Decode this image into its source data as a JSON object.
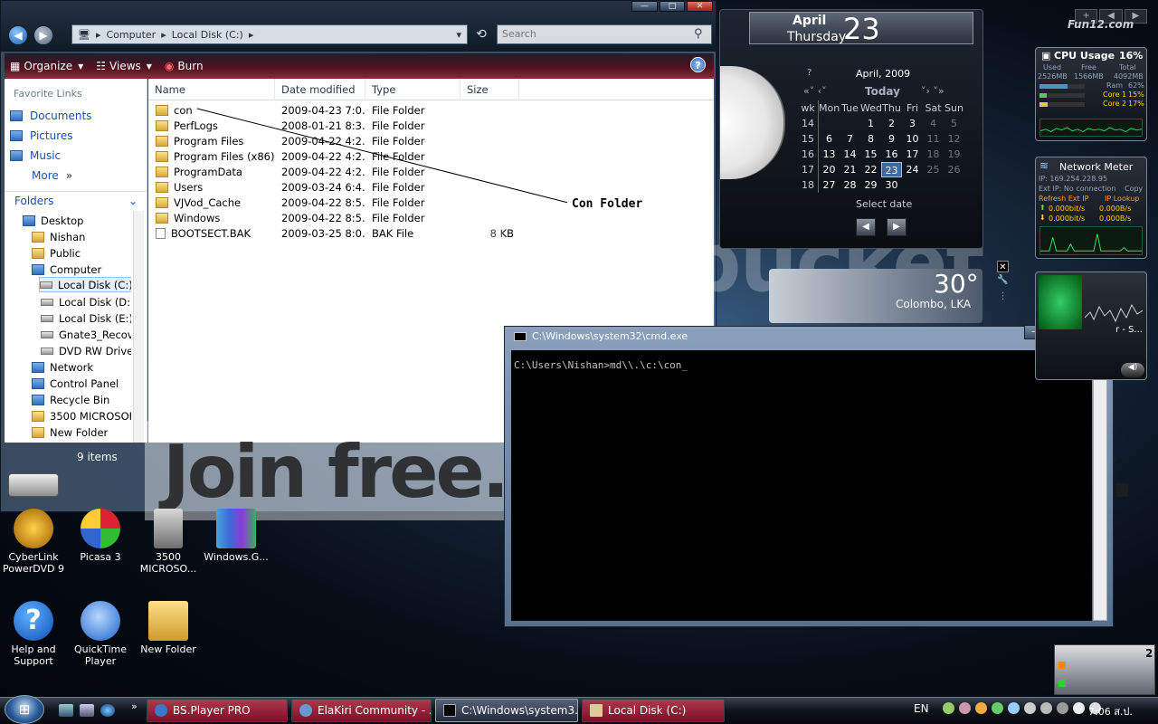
{
  "explorer": {
    "address": {
      "crumbs": [
        "Computer",
        "Local Disk (C:)"
      ],
      "search_placeholder": "Search"
    },
    "window_buttons": {
      "minimize": "—",
      "maximize": "□",
      "close": "✕"
    },
    "toolbar": {
      "organize": "Organize",
      "views": "Views",
      "burn": "Burn",
      "help": "?"
    },
    "favorite_links": {
      "title": "Favorite Links",
      "items": [
        "Documents",
        "Pictures",
        "Music",
        "More"
      ]
    },
    "folders_header": "Folders",
    "tree": [
      "Desktop",
      "Nishan",
      "Public",
      "Computer",
      "Local Disk (C:)",
      "Local Disk (D:)",
      "Local Disk (E:)",
      "Gnate3_Recove",
      "DVD RW Drive",
      "Network",
      "Control Panel",
      "Recycle Bin",
      "3500 MICROSOFT",
      "New Folder"
    ],
    "columns": [
      "Name",
      "Date modified",
      "Type",
      "Size"
    ],
    "rows": [
      {
        "name": "con",
        "date": "2009-04-23 7:0...",
        "type": "File Folder",
        "size": ""
      },
      {
        "name": "PerfLogs",
        "date": "2008-01-21 8:3...",
        "type": "File Folder",
        "size": ""
      },
      {
        "name": "Program Files",
        "date": "2009-04-22 4:2...",
        "type": "File Folder",
        "size": ""
      },
      {
        "name": "Program Files (x86)",
        "date": "2009-04-22 4:2...",
        "type": "File Folder",
        "size": ""
      },
      {
        "name": "ProgramData",
        "date": "2009-04-22 4:2...",
        "type": "File Folder",
        "size": ""
      },
      {
        "name": "Users",
        "date": "2009-03-24 6:4...",
        "type": "File Folder",
        "size": ""
      },
      {
        "name": "VJVod_Cache",
        "date": "2009-04-22 8:5...",
        "type": "File Folder",
        "size": ""
      },
      {
        "name": "Windows",
        "date": "2009-04-22 8:5...",
        "type": "File Folder",
        "size": ""
      },
      {
        "name": "BOOTSECT.BAK",
        "date": "2009-03-25 8:0...",
        "type": "BAK File",
        "size": "8 KB"
      }
    ],
    "status": "9 items"
  },
  "annotation": {
    "label": "Con Folder"
  },
  "watermark": {
    "slogan": "Join free. Share privately.",
    "brand": "photobucket"
  },
  "cmd": {
    "title": "C:\\Windows\\system32\\cmd.exe",
    "line": "C:\\Users\\Nishan>md\\\\.\\c:\\con_"
  },
  "calendar": {
    "month": "April",
    "weekday": "Thursday",
    "day": "23",
    "header": "April, 2009",
    "today": "Today",
    "help": "?",
    "select_date": "Select date",
    "col_headers": [
      "wk",
      "Mon",
      "Tue",
      "Wed",
      "Thu",
      "Fri",
      "Sat",
      "Sun"
    ],
    "weeks": [
      [
        "14",
        "",
        "",
        "1",
        "2",
        "3",
        "4",
        "5"
      ],
      [
        "15",
        "6",
        "7",
        "8",
        "9",
        "10",
        "11",
        "12"
      ],
      [
        "16",
        "13",
        "14",
        "15",
        "16",
        "17",
        "18",
        "19"
      ],
      [
        "17",
        "20",
        "21",
        "22",
        "23",
        "24",
        "25",
        "26"
      ],
      [
        "18",
        "27",
        "28",
        "29",
        "30",
        "",
        "",
        ""
      ]
    ],
    "today_value": "23"
  },
  "weather": {
    "temp": "30°",
    "city": "Colombo, LKA"
  },
  "fun": {
    "title": "Fun12.com"
  },
  "cpu_gadget": {
    "title": "CPU Usage",
    "percent": "16%",
    "labels": [
      "Used",
      "Free",
      "Total"
    ],
    "values": [
      "2526MB",
      "1566MB",
      "4092MB"
    ],
    "ram": {
      "label": "Ram",
      "value": "62%",
      "fraction": 0.62
    },
    "core1": {
      "label": "Core 1",
      "value": "15%",
      "fraction": 0.15
    },
    "core2": {
      "label": "Core 2",
      "value": "17%",
      "fraction": 0.17
    }
  },
  "net_gadget": {
    "title": "Network Meter",
    "ip": "IP: 169.254.228.95",
    "ext_ip": "Ext IP: No connection",
    "copy": "Copy",
    "refresh": "Refresh Ext IP",
    "lookup": "IP Lookup",
    "up": [
      "0.000bit/s",
      "0.000B/s"
    ],
    "down": [
      "0.000bit/s",
      "0.000B/s"
    ]
  },
  "media_gadget": {
    "text": "r - S..."
  },
  "desktop_icons": [
    {
      "name": "CyberLink PowerDVD 9"
    },
    {
      "name": "Picasa 3"
    },
    {
      "name": "3500 MICROSO..."
    },
    {
      "name": "Windows.G..."
    },
    {
      "name": "Help and Support"
    },
    {
      "name": "QuickTime Player"
    },
    {
      "name": "New Folder"
    }
  ],
  "mini_gadget": {
    "count": "2"
  },
  "taskbar": {
    "tasks": [
      "BS.Player PRO",
      "ElaKiri Community - ...",
      "C:\\Windows\\system3...",
      "Local Disk (C:)"
    ],
    "lang": "EN",
    "clock": "7:06 ส.ป."
  }
}
